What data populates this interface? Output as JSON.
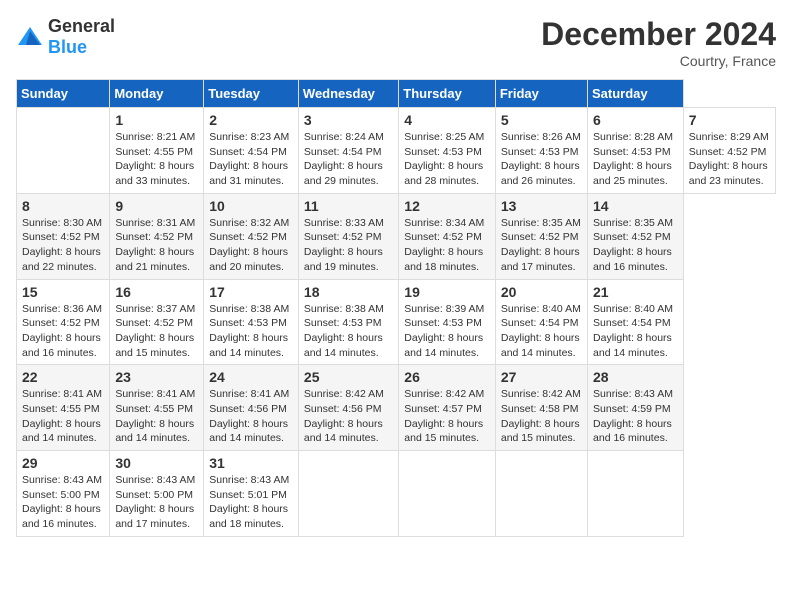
{
  "header": {
    "logo_general": "General",
    "logo_blue": "Blue",
    "month_title": "December 2024",
    "location": "Courtry, France"
  },
  "calendar": {
    "days_of_week": [
      "Sunday",
      "Monday",
      "Tuesday",
      "Wednesday",
      "Thursday",
      "Friday",
      "Saturday"
    ],
    "weeks": [
      [
        null,
        {
          "day": "1",
          "sunrise": "8:21 AM",
          "sunset": "4:55 PM",
          "daylight_hours": "8 hours and 33 minutes."
        },
        {
          "day": "2",
          "sunrise": "8:23 AM",
          "sunset": "4:54 PM",
          "daylight_hours": "8 hours and 31 minutes."
        },
        {
          "day": "3",
          "sunrise": "8:24 AM",
          "sunset": "4:54 PM",
          "daylight_hours": "8 hours and 29 minutes."
        },
        {
          "day": "4",
          "sunrise": "8:25 AM",
          "sunset": "4:53 PM",
          "daylight_hours": "8 hours and 28 minutes."
        },
        {
          "day": "5",
          "sunrise": "8:26 AM",
          "sunset": "4:53 PM",
          "daylight_hours": "8 hours and 26 minutes."
        },
        {
          "day": "6",
          "sunrise": "8:28 AM",
          "sunset": "4:53 PM",
          "daylight_hours": "8 hours and 25 minutes."
        },
        {
          "day": "7",
          "sunrise": "8:29 AM",
          "sunset": "4:52 PM",
          "daylight_hours": "8 hours and 23 minutes."
        }
      ],
      [
        {
          "day": "8",
          "sunrise": "8:30 AM",
          "sunset": "4:52 PM",
          "daylight_hours": "8 hours and 22 minutes."
        },
        {
          "day": "9",
          "sunrise": "8:31 AM",
          "sunset": "4:52 PM",
          "daylight_hours": "8 hours and 21 minutes."
        },
        {
          "day": "10",
          "sunrise": "8:32 AM",
          "sunset": "4:52 PM",
          "daylight_hours": "8 hours and 20 minutes."
        },
        {
          "day": "11",
          "sunrise": "8:33 AM",
          "sunset": "4:52 PM",
          "daylight_hours": "8 hours and 19 minutes."
        },
        {
          "day": "12",
          "sunrise": "8:34 AM",
          "sunset": "4:52 PM",
          "daylight_hours": "8 hours and 18 minutes."
        },
        {
          "day": "13",
          "sunrise": "8:35 AM",
          "sunset": "4:52 PM",
          "daylight_hours": "8 hours and 17 minutes."
        },
        {
          "day": "14",
          "sunrise": "8:35 AM",
          "sunset": "4:52 PM",
          "daylight_hours": "8 hours and 16 minutes."
        }
      ],
      [
        {
          "day": "15",
          "sunrise": "8:36 AM",
          "sunset": "4:52 PM",
          "daylight_hours": "8 hours and 16 minutes."
        },
        {
          "day": "16",
          "sunrise": "8:37 AM",
          "sunset": "4:52 PM",
          "daylight_hours": "8 hours and 15 minutes."
        },
        {
          "day": "17",
          "sunrise": "8:38 AM",
          "sunset": "4:53 PM",
          "daylight_hours": "8 hours and 14 minutes."
        },
        {
          "day": "18",
          "sunrise": "8:38 AM",
          "sunset": "4:53 PM",
          "daylight_hours": "8 hours and 14 minutes."
        },
        {
          "day": "19",
          "sunrise": "8:39 AM",
          "sunset": "4:53 PM",
          "daylight_hours": "8 hours and 14 minutes."
        },
        {
          "day": "20",
          "sunrise": "8:40 AM",
          "sunset": "4:54 PM",
          "daylight_hours": "8 hours and 14 minutes."
        },
        {
          "day": "21",
          "sunrise": "8:40 AM",
          "sunset": "4:54 PM",
          "daylight_hours": "8 hours and 14 minutes."
        }
      ],
      [
        {
          "day": "22",
          "sunrise": "8:41 AM",
          "sunset": "4:55 PM",
          "daylight_hours": "8 hours and 14 minutes."
        },
        {
          "day": "23",
          "sunrise": "8:41 AM",
          "sunset": "4:55 PM",
          "daylight_hours": "8 hours and 14 minutes."
        },
        {
          "day": "24",
          "sunrise": "8:41 AM",
          "sunset": "4:56 PM",
          "daylight_hours": "8 hours and 14 minutes."
        },
        {
          "day": "25",
          "sunrise": "8:42 AM",
          "sunset": "4:56 PM",
          "daylight_hours": "8 hours and 14 minutes."
        },
        {
          "day": "26",
          "sunrise": "8:42 AM",
          "sunset": "4:57 PM",
          "daylight_hours": "8 hours and 15 minutes."
        },
        {
          "day": "27",
          "sunrise": "8:42 AM",
          "sunset": "4:58 PM",
          "daylight_hours": "8 hours and 15 minutes."
        },
        {
          "day": "28",
          "sunrise": "8:43 AM",
          "sunset": "4:59 PM",
          "daylight_hours": "8 hours and 16 minutes."
        }
      ],
      [
        {
          "day": "29",
          "sunrise": "8:43 AM",
          "sunset": "5:00 PM",
          "daylight_hours": "8 hours and 16 minutes."
        },
        {
          "day": "30",
          "sunrise": "8:43 AM",
          "sunset": "5:00 PM",
          "daylight_hours": "8 hours and 17 minutes."
        },
        {
          "day": "31",
          "sunrise": "8:43 AM",
          "sunset": "5:01 PM",
          "daylight_hours": "8 hours and 18 minutes."
        },
        null,
        null,
        null,
        null
      ]
    ],
    "labels": {
      "sunrise": "Sunrise:",
      "sunset": "Sunset:",
      "daylight": "Daylight:"
    }
  }
}
